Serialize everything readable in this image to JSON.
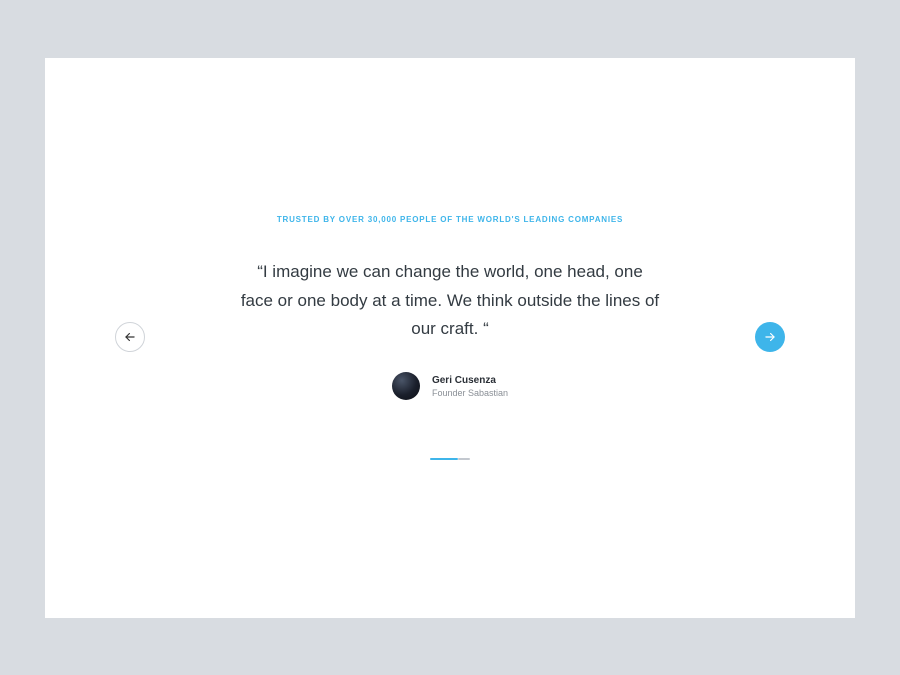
{
  "eyebrow": "TRUSTED BY OVER 30,000 PEOPLE OF THE WORLD'S LEADING COMPANIES",
  "quote": "“I imagine we can change the world, one head, one face or one body at a time. We think outside the lines of our craft. “",
  "author": {
    "name": "Geri Cusenza",
    "role": "Founder Sabastian"
  },
  "colors": {
    "accent": "#3eb5ea",
    "page_bg": "#d8dce1",
    "card_bg": "#ffffff"
  },
  "carousel": {
    "active_index": 0,
    "count": 2
  }
}
